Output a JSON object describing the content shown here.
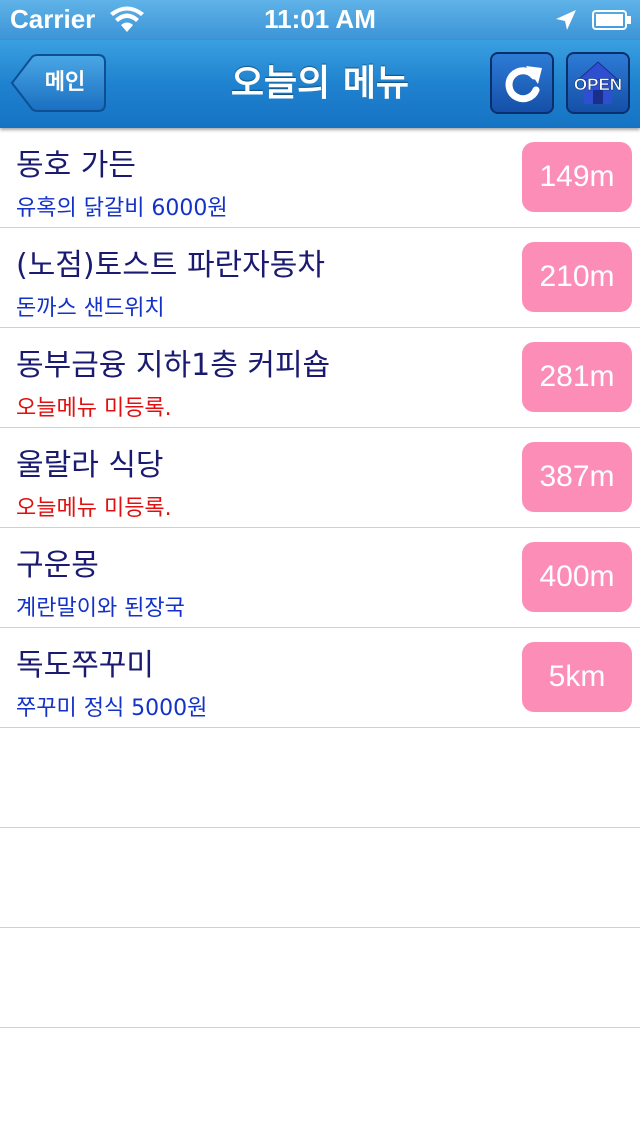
{
  "status": {
    "carrier": "Carrier",
    "time": "11:01 AM"
  },
  "nav": {
    "back_label": "메인",
    "title": "오늘의 메뉴",
    "open_label": "OPEN"
  },
  "rows": [
    {
      "name": "동호 가든",
      "menu": "유혹의 닭갈비 6000원",
      "distance": "149m",
      "registered": true
    },
    {
      "name": "(노점)토스트 파란자동차",
      "menu": "돈까스 샌드위치",
      "distance": "210m",
      "registered": true
    },
    {
      "name": "동부금융 지하1층 커피숍",
      "menu": "오늘메뉴 미등록.",
      "distance": "281m",
      "registered": false
    },
    {
      "name": "울랄라 식당",
      "menu": "오늘메뉴 미등록.",
      "distance": "387m",
      "registered": false
    },
    {
      "name": "구운몽",
      "menu": "계란말이와 된장국",
      "distance": "400m",
      "registered": true
    },
    {
      "name": "독도쭈꾸미",
      "menu": "쭈꾸미 정식 5000원",
      "distance": "5km",
      "registered": true
    }
  ],
  "colors": {
    "nav_blue": "#1f82cf",
    "distance_badge": "#fb8db7",
    "menu_text": "#1432c8",
    "unregistered_text": "#e01010"
  }
}
